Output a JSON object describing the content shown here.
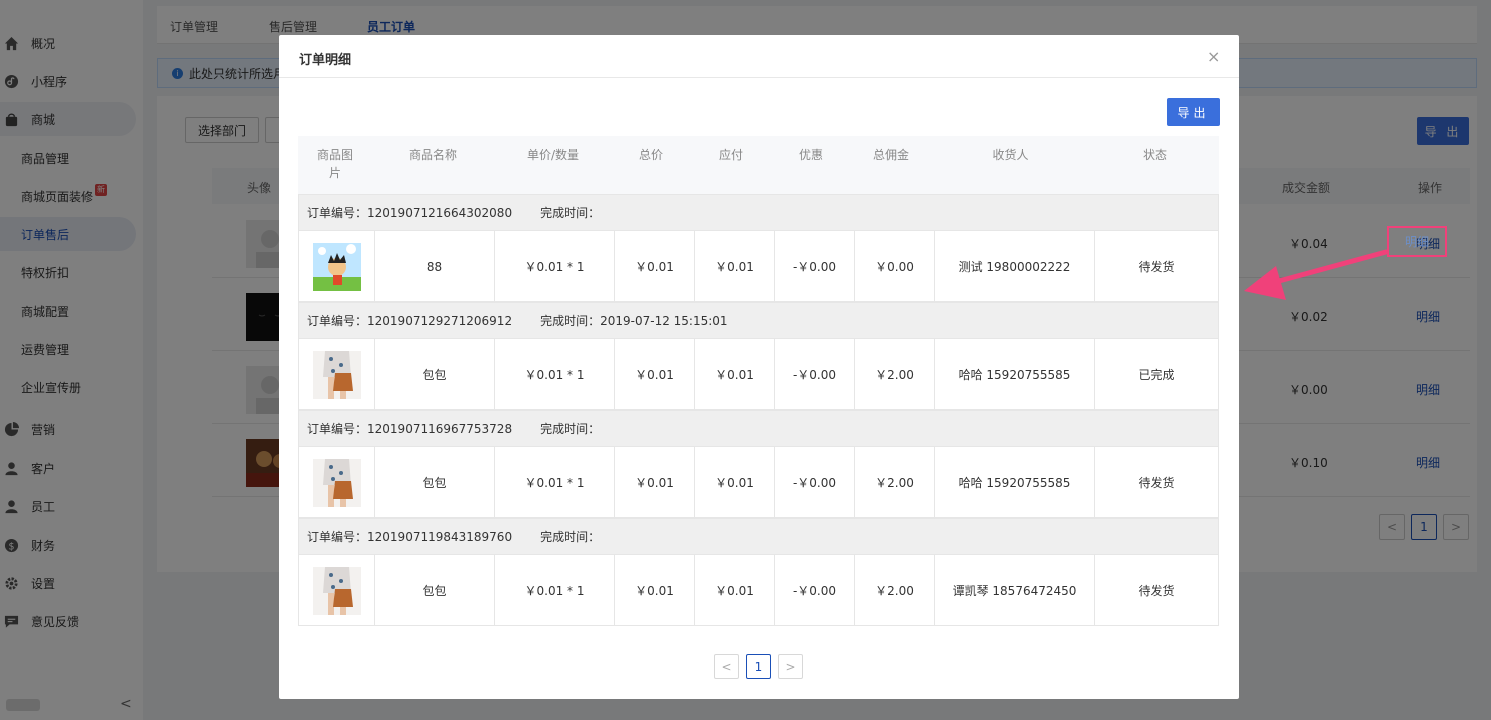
{
  "sidebar": {
    "menu": [
      {
        "label": "概况",
        "icon": "home-icon"
      },
      {
        "label": "小程序",
        "icon": "miniprogram-icon"
      },
      {
        "label": "商城",
        "icon": "shopping-bag-icon"
      }
    ],
    "sub_items": [
      {
        "label": "商品管理"
      },
      {
        "label": "商城页面装修",
        "badge": "新"
      },
      {
        "label": "订单售后"
      },
      {
        "label": "特权折扣"
      },
      {
        "label": "商城配置"
      },
      {
        "label": "运费管理"
      },
      {
        "label": "企业宣传册"
      }
    ],
    "menu2": [
      {
        "label": "营销",
        "icon": "pie-chart-icon"
      },
      {
        "label": "客户",
        "icon": "customer-icon"
      },
      {
        "label": "员工",
        "icon": "employee-icon"
      },
      {
        "label": "财务",
        "icon": "finance-icon"
      },
      {
        "label": "设置",
        "icon": "gear-icon"
      },
      {
        "label": "意见反馈",
        "icon": "feedback-icon"
      }
    ],
    "collapse": "<"
  },
  "main": {
    "tabs": [
      {
        "label": "订单管理"
      },
      {
        "label": "售后管理"
      },
      {
        "label": "员工订单"
      }
    ],
    "info_text": "此处只统计所选月",
    "select_dept": "选择部门",
    "export_label": "导 出",
    "columns": {
      "avatar": "头像",
      "amount": "成交金额",
      "op": "操作"
    },
    "rows": [
      {
        "amount": "￥0.04",
        "op": "明细"
      },
      {
        "amount": "￥0.02",
        "op": "明细"
      },
      {
        "amount": "￥0.00",
        "op": "明细"
      },
      {
        "amount": "￥0.10",
        "op": "明细"
      }
    ],
    "page": "1"
  },
  "modal": {
    "title": "订单明细",
    "close": "×",
    "export_label": "导出",
    "columns": {
      "image": "商品图片",
      "name": "商品名称",
      "price_qty": "单价/数量",
      "total": "总价",
      "payable": "应付",
      "discount": "优惠",
      "commission": "总佣金",
      "receiver": "收货人",
      "status": "状态"
    },
    "order_no_label": "订单编号：",
    "finish_label": "完成时间：",
    "orders": [
      {
        "order_no": "1201907121664302080",
        "finish_time": "",
        "image": "cartoon-boy",
        "name": "88",
        "price_qty": "￥0.01 * 1",
        "total": "￥0.01",
        "payable": "￥0.01",
        "discount": "-￥0.00",
        "commission": "￥0.00",
        "receiver": "测试 19800002222",
        "status": "待发货"
      },
      {
        "order_no": "1201907129271206912",
        "finish_time": "2019-07-12 15:15:01",
        "image": "bag-girl",
        "name": "包包",
        "price_qty": "￥0.01 * 1",
        "total": "￥0.01",
        "payable": "￥0.01",
        "discount": "-￥0.00",
        "commission": "￥2.00",
        "receiver": "哈哈 15920755585",
        "status": "已完成"
      },
      {
        "order_no": "1201907116967753728",
        "finish_time": "",
        "image": "bag-girl",
        "name": "包包",
        "price_qty": "￥0.01 * 1",
        "total": "￥0.01",
        "payable": "￥0.01",
        "discount": "-￥0.00",
        "commission": "￥2.00",
        "receiver": "哈哈 15920755585",
        "status": "待发货"
      },
      {
        "order_no": "1201907119843189760",
        "finish_time": "",
        "image": "bag-girl",
        "name": "包包",
        "price_qty": "￥0.01 * 1",
        "total": "￥0.01",
        "payable": "￥0.01",
        "discount": "-￥0.00",
        "commission": "￥2.00",
        "receiver": "谭凯琴 18576472450",
        "status": "待发货"
      }
    ],
    "pager": {
      "prev": "<",
      "page": "1",
      "next": ">"
    }
  },
  "annotation": {
    "highlight_label": "明细",
    "arrow_color": "#f0417a"
  }
}
